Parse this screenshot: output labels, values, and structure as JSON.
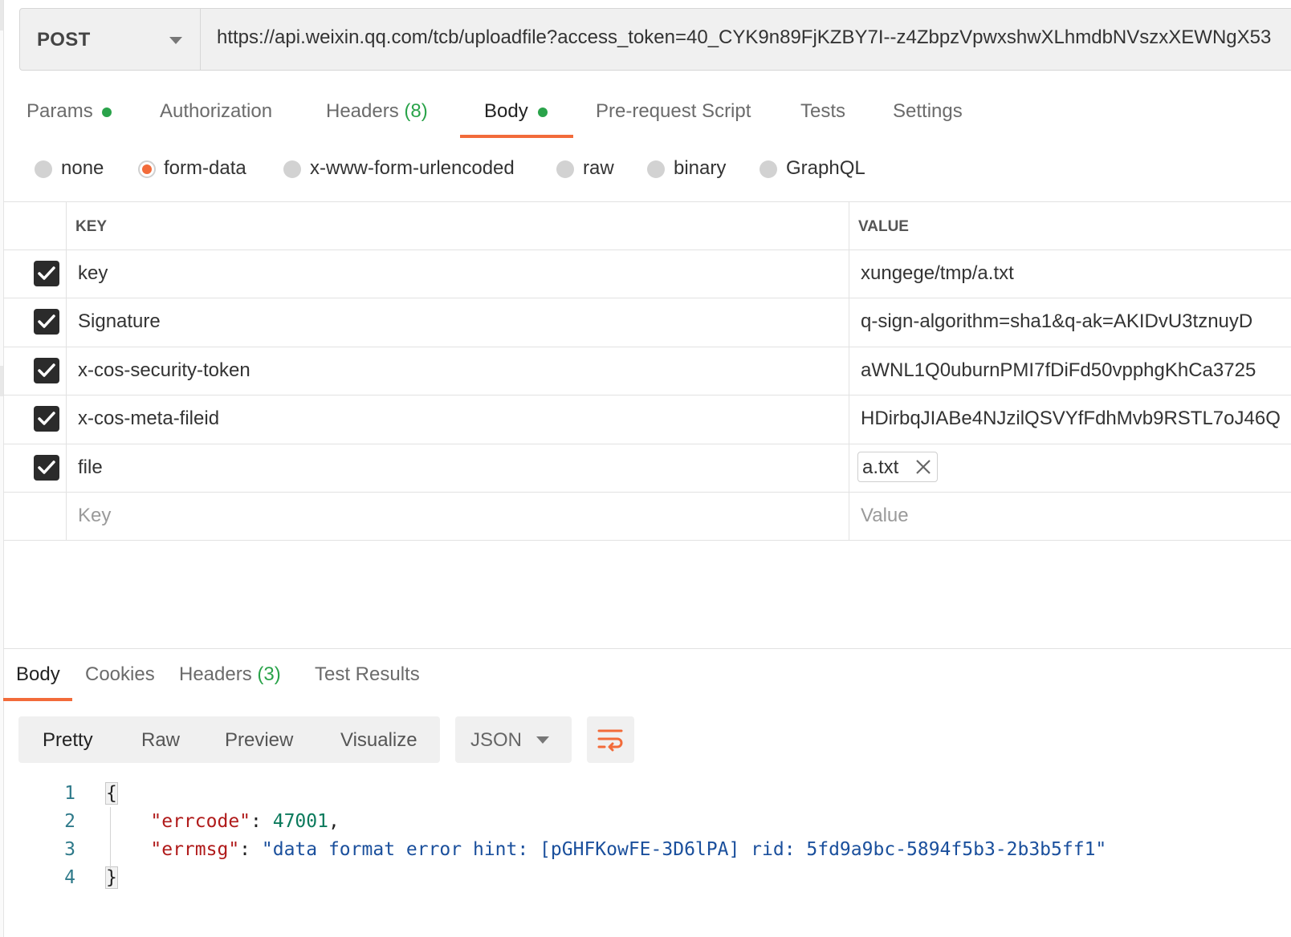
{
  "request": {
    "method": "POST",
    "url": "https://api.weixin.qq.com/tcb/uploadfile?access_token=40_CYK9n89FjKZBY7I--z4ZbpzVpwxshwXLhmdbNVszxXEWNgX53"
  },
  "request_tabs": {
    "params": "Params",
    "authorization": "Authorization",
    "headers": "Headers",
    "headers_count": "(8)",
    "body": "Body",
    "prerequest": "Pre-request Script",
    "tests": "Tests",
    "settings": "Settings"
  },
  "body_types": {
    "none": "none",
    "form_data": "form-data",
    "urlencoded": "x-www-form-urlencoded",
    "raw": "raw",
    "binary": "binary",
    "graphql": "GraphQL",
    "selected": "form-data"
  },
  "table": {
    "key_header": "KEY",
    "value_header": "VALUE",
    "rows": [
      {
        "key": "key",
        "value": "xungege/tmp/a.txt",
        "checked": true
      },
      {
        "key": "Signature",
        "value": "q-sign-algorithm=sha1&q-ak=AKIDvU3tznuyD",
        "checked": true
      },
      {
        "key": "x-cos-security-token",
        "value": "aWNL1Q0uburnPMI7fDiFd50vpphgKhCa3725",
        "checked": true
      },
      {
        "key": "x-cos-meta-fileid",
        "value": "HDirbqJIABe4NJzilQSVYfFdhMvb9RSTL7oJ46Q",
        "checked": true
      },
      {
        "key": "file",
        "value": "a.txt",
        "checked": true
      }
    ],
    "key_placeholder": "Key",
    "value_placeholder": "Value"
  },
  "response_tabs": {
    "body": "Body",
    "cookies": "Cookies",
    "headers": "Headers",
    "headers_count": "(3)",
    "test_results": "Test Results"
  },
  "response_view": {
    "pretty": "Pretty",
    "raw": "Raw",
    "preview": "Preview",
    "visualize": "Visualize",
    "format": "JSON"
  },
  "response_body": {
    "line_numbers": [
      "1",
      "2",
      "3",
      "4"
    ],
    "open_brace": "{",
    "close_brace": "}",
    "errcode_key": "\"errcode\"",
    "errcode_value": "47001",
    "errmsg_key": "\"errmsg\"",
    "errmsg_value": "\"data format error hint: [pGHFKowFE-3D6lPA] rid: 5fd9a9bc-5894f5b3-2b3b5ff1\""
  },
  "colors": {
    "accent": "#f26b3a",
    "green_dot": "#2aa34a",
    "json_key": "#b01a1a",
    "json_number": "#0b7a5c",
    "json_string": "#1a4f9c"
  }
}
